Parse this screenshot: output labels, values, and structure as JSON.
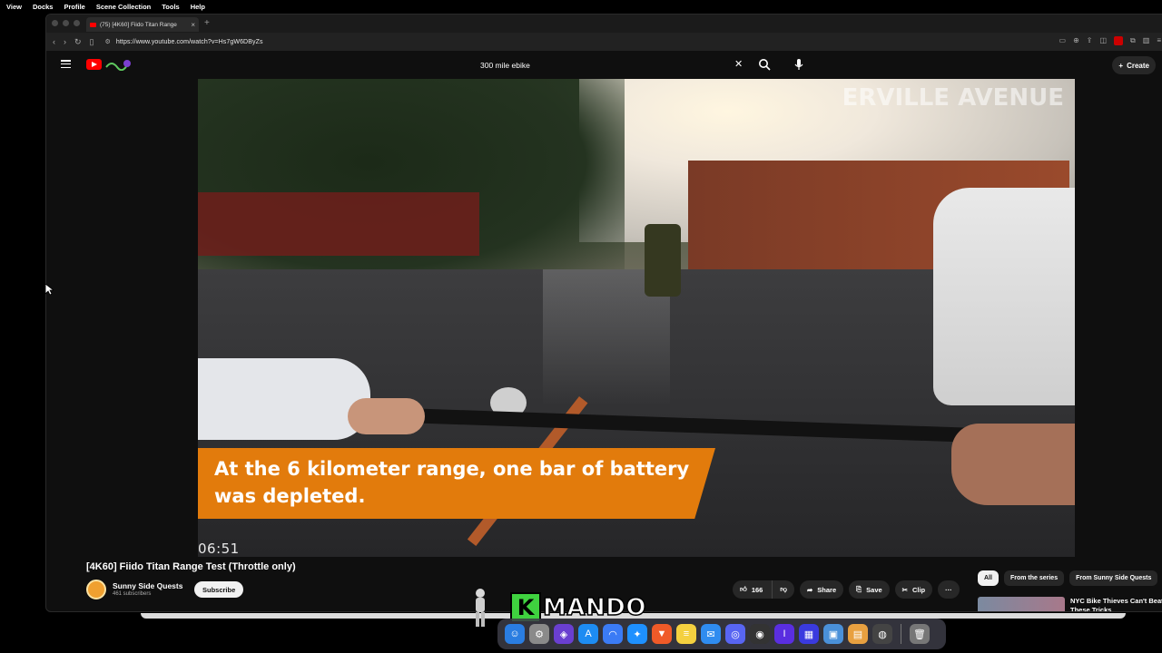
{
  "os_menu": [
    "View",
    "Docks",
    "Profile",
    "Scene Collection",
    "Tools",
    "Help"
  ],
  "browser": {
    "tab_title": "(75) [4K60] Fiido Titan Range",
    "url": "https://www.youtube.com/watch?v=Hs7gW6DByZs"
  },
  "youtube": {
    "search_query": "300 mile ebike",
    "create_label": "Create"
  },
  "video": {
    "caption": "At the 6 kilometer range, one bar of battery was depleted.",
    "timestamp": "06:51",
    "watermark": "ERVILLE AVENUE"
  },
  "details": {
    "title": "[4K60] Fiido Titan Range Test (Throttle only)",
    "channel_name": "Sunny Side Quests",
    "subscribers": "461 subscribers",
    "subscribe_label": "Subscribe",
    "likes": "166",
    "share_label": "Share",
    "save_label": "Save",
    "clip_label": "Clip",
    "more_label": "···"
  },
  "sidebar": {
    "chips": [
      "All",
      "From the series",
      "From Sunny Side Quests"
    ],
    "rec_title": "NYC Bike Thieves Can't Beat These Tricks"
  },
  "overlay": {
    "brand_letter": "K",
    "brand_text": "MANDO"
  },
  "colors": {
    "caption_bg": "#e27b0c",
    "yt_red": "#ff0000",
    "accent_green": "#3fd23f"
  }
}
